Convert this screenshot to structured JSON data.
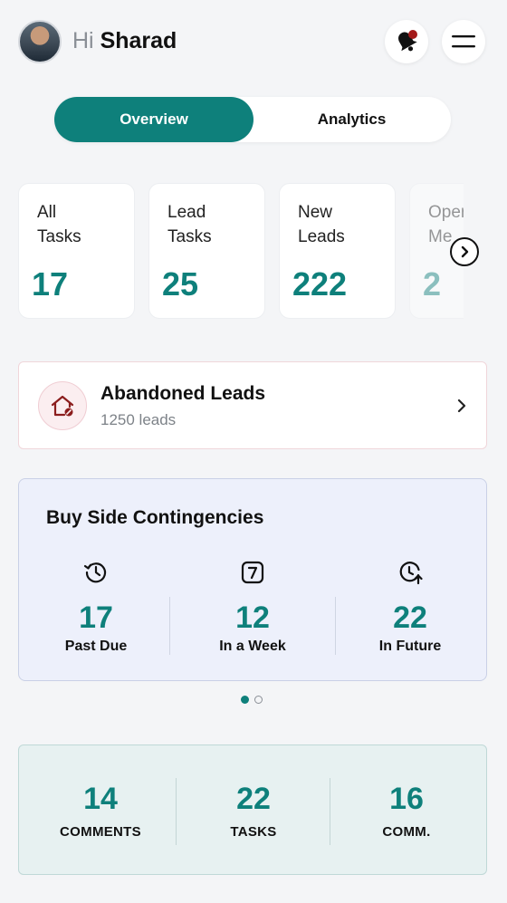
{
  "header": {
    "greeting_prefix": "Hi",
    "user_name": "Sharad",
    "avatar_icon": "avatar",
    "notification_icon": "bell-icon",
    "menu_icon": "hamburger-menu-icon"
  },
  "tabs": [
    {
      "label": "Overview",
      "active": true
    },
    {
      "label": "Analytics",
      "active": false
    }
  ],
  "stat_cards": [
    {
      "label_line1": "All",
      "label_line2": "Tasks",
      "value": "17"
    },
    {
      "label_line1": "Lead",
      "label_line2": "Tasks",
      "value": "25"
    },
    {
      "label_line1": "New",
      "label_line2": "Leads",
      "value": "222"
    },
    {
      "label_line1": "Oper",
      "label_line2": "Me",
      "value": "2"
    }
  ],
  "abandoned_leads": {
    "title": "Abandoned Leads",
    "subtitle": "1250 leads",
    "icon": "house-icon"
  },
  "contingencies": {
    "title": "Buy Side Contingencies",
    "items": [
      {
        "value": "17",
        "label": "Past Due",
        "icon": "history-icon"
      },
      {
        "value": "12",
        "label": "In a Week",
        "icon": "calendar-7-icon"
      },
      {
        "value": "22",
        "label": "In Future",
        "icon": "clock-up-icon"
      }
    ],
    "page_dots": 2,
    "active_dot": 0
  },
  "bottom_stats": [
    {
      "value": "14",
      "label": "COMMENTS"
    },
    {
      "value": "22",
      "label": "TASKS"
    },
    {
      "value": "16",
      "label": "COMM."
    }
  ],
  "colors": {
    "accent": "#0e807b",
    "background": "#f4f5f7",
    "contingency_bg": "#edf0fb",
    "bottom_bg": "#e7f1f1",
    "alert_red": "#a31a1a"
  }
}
